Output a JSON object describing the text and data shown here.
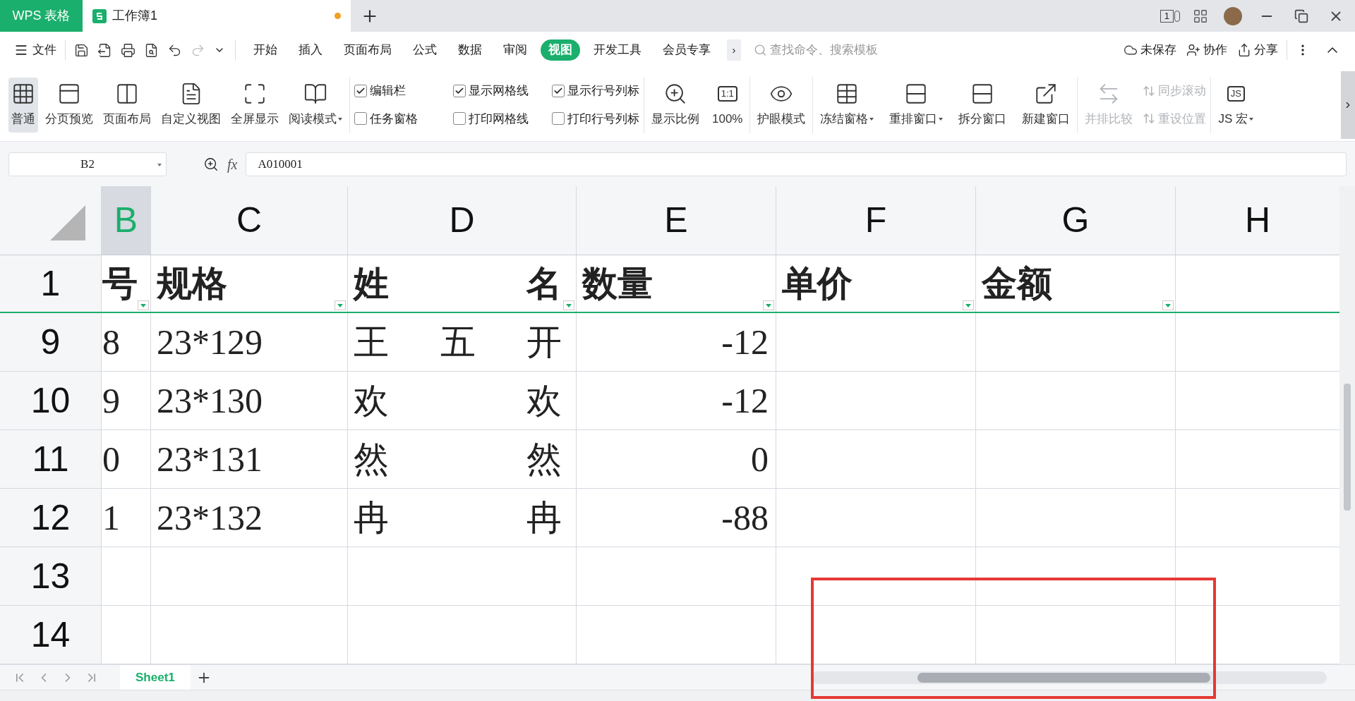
{
  "title_bar": {
    "app_tab": "WPS 表格",
    "doc_tab": {
      "title": "工作簿1",
      "unsaved": true
    },
    "device_badge": "1"
  },
  "menu": {
    "file": "文件",
    "tabs": [
      {
        "label": "开始",
        "selected": false
      },
      {
        "label": "插入",
        "selected": false
      },
      {
        "label": "页面布局",
        "selected": false
      },
      {
        "label": "公式",
        "selected": false
      },
      {
        "label": "数据",
        "selected": false
      },
      {
        "label": "审阅",
        "selected": false
      },
      {
        "label": "视图",
        "selected": true
      },
      {
        "label": "开发工具",
        "selected": false
      },
      {
        "label": "会员专享",
        "selected": false
      }
    ],
    "more": "›",
    "search": {
      "placeholder": "查找命令、搜索模板"
    },
    "actions": [
      "未保存",
      "协作",
      "分享"
    ]
  },
  "ribbon": {
    "views": [
      {
        "label": "普通",
        "selected": true,
        "dropdown": false
      },
      {
        "label": "分页预览",
        "selected": false,
        "dropdown": false
      },
      {
        "label": "页面布局",
        "selected": false,
        "dropdown": false
      },
      {
        "label": "自定义视图",
        "selected": false,
        "dropdown": false
      },
      {
        "label": "全屏显示",
        "selected": false,
        "dropdown": false
      },
      {
        "label": "阅读模式",
        "selected": false,
        "dropdown": true
      }
    ],
    "checkboxes": [
      {
        "label": "编辑栏",
        "checked": true
      },
      {
        "label": "显示网格线",
        "checked": true
      },
      {
        "label": "显示行号列标",
        "checked": true
      },
      {
        "label": "任务窗格",
        "checked": false
      },
      {
        "label": "打印网格线",
        "checked": false
      },
      {
        "label": "打印行号列标",
        "checked": false
      }
    ],
    "zoom": [
      {
        "label": "显示比例"
      },
      {
        "label": "100%",
        "icon_text": "1:1"
      }
    ],
    "eye": {
      "label": "护眼模式"
    },
    "windows": [
      {
        "label": "冻结窗格",
        "dropdown": true
      },
      {
        "label": "重排窗口",
        "dropdown": true
      },
      {
        "label": "拆分窗口",
        "dropdown": false
      },
      {
        "label": "新建窗口",
        "dropdown": false
      }
    ],
    "compare": {
      "label": "并排比较",
      "disabled": true
    },
    "sync": [
      {
        "label": "同步滚动",
        "disabled": true
      },
      {
        "label": "重设位置",
        "disabled": true
      }
    ],
    "macro": {
      "label": "JS 宏",
      "icon_text": "JS",
      "dropdown": true
    }
  },
  "formula_bar": {
    "name_box": "B2",
    "fx": "fx",
    "value": "A010001"
  },
  "columns": [
    {
      "label": "B",
      "selected": true
    },
    {
      "label": "C",
      "selected": false
    },
    {
      "label": "D",
      "selected": false
    },
    {
      "label": "E",
      "selected": false
    },
    {
      "label": "F",
      "selected": false
    },
    {
      "label": "G",
      "selected": false
    },
    {
      "label": "H",
      "selected": false
    }
  ],
  "rows": [
    {
      "number": "1",
      "header": true,
      "cells": [
        {
          "text": "号",
          "kind": "text",
          "filter": true
        },
        {
          "text": "规格",
          "kind": "text",
          "filter": true
        },
        {
          "text": "姓名",
          "kind": "distributed",
          "filter": true
        },
        {
          "text": "数量",
          "kind": "text",
          "filter": true
        },
        {
          "text": "单价",
          "kind": "text",
          "filter": true
        },
        {
          "text": "金额",
          "kind": "text",
          "filter": true
        },
        null
      ]
    },
    {
      "number": "9",
      "header": false,
      "cells": [
        {
          "text": "8",
          "kind": "text",
          "filter": false
        },
        {
          "text": "23*129",
          "kind": "text",
          "filter": false
        },
        {
          "text": "王五开",
          "kind": "distributed",
          "filter": false
        },
        {
          "text": "-12",
          "kind": "number",
          "filter": false
        },
        null,
        null,
        null
      ]
    },
    {
      "number": "10",
      "header": false,
      "cells": [
        {
          "text": "9",
          "kind": "text",
          "filter": false
        },
        {
          "text": "23*130",
          "kind": "text",
          "filter": false
        },
        {
          "text": "欢欢",
          "kind": "distributed",
          "filter": false
        },
        {
          "text": "-12",
          "kind": "number",
          "filter": false
        },
        null,
        null,
        null
      ]
    },
    {
      "number": "11",
      "header": false,
      "cells": [
        {
          "text": "0",
          "kind": "text",
          "filter": false
        },
        {
          "text": "23*131",
          "kind": "text",
          "filter": false
        },
        {
          "text": "然然",
          "kind": "distributed",
          "filter": false
        },
        {
          "text": "0",
          "kind": "number",
          "filter": false
        },
        null,
        null,
        null
      ]
    },
    {
      "number": "12",
      "header": false,
      "cells": [
        {
          "text": "1",
          "kind": "text",
          "filter": false
        },
        {
          "text": "23*132",
          "kind": "text",
          "filter": false
        },
        {
          "text": "冉冉",
          "kind": "distributed",
          "filter": false
        },
        {
          "text": "-88",
          "kind": "number",
          "filter": false
        },
        null,
        null,
        null
      ]
    },
    {
      "number": "13",
      "header": false
    },
    {
      "number": "14",
      "header": false
    }
  ],
  "sheets": [
    {
      "label": "Sheet1",
      "selected": true
    }
  ],
  "annotations": [
    {
      "kind": "rectangle"
    }
  ]
}
